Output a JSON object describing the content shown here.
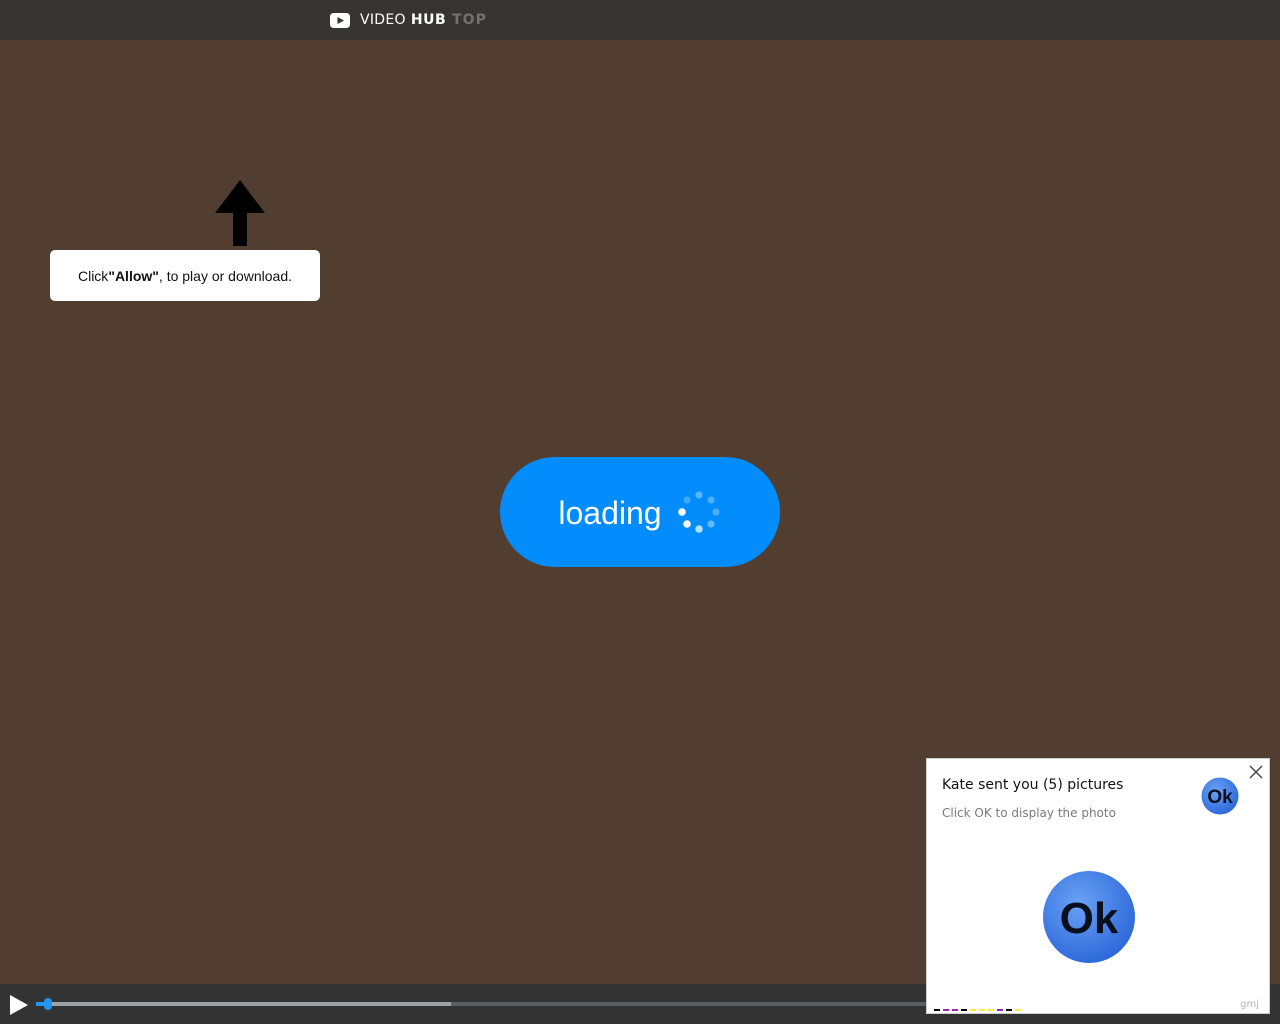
{
  "header": {
    "logo_part_a": "VIDEO",
    "logo_part_b": "HUB",
    "logo_part_c": "TOP",
    "logo_icon": "play-logo-icon"
  },
  "prompt": {
    "text_before": "Click ",
    "text_bold": "\"Allow\"",
    "text_after": ", to play or download.",
    "arrow_icon": "arrow-up-icon"
  },
  "loading": {
    "label": "loading",
    "spinner_icon": "spinner-icon",
    "color": "#028cfc"
  },
  "player": {
    "play_icon": "play-icon",
    "played_fraction": 0.014,
    "buffered_fraction": 0.466,
    "accent": "#2196f3"
  },
  "notification": {
    "title": "Kate sent you (5) pictures",
    "subtitle": "Click OK to display the photo",
    "ok_label": "Ok",
    "close_icon": "close-icon",
    "brand": "gmj",
    "strip_colors": [
      "#000000",
      "#9c27b0",
      "#9c27b0",
      "#000000",
      "#ffeb3b",
      "#ffeb3b",
      "#ffeb3b",
      "#9c27b0",
      "#000000",
      "#ffeb3b"
    ]
  },
  "colors": {
    "background": "#513e30",
    "topbar": "#373431",
    "player_bar": "#333333"
  }
}
